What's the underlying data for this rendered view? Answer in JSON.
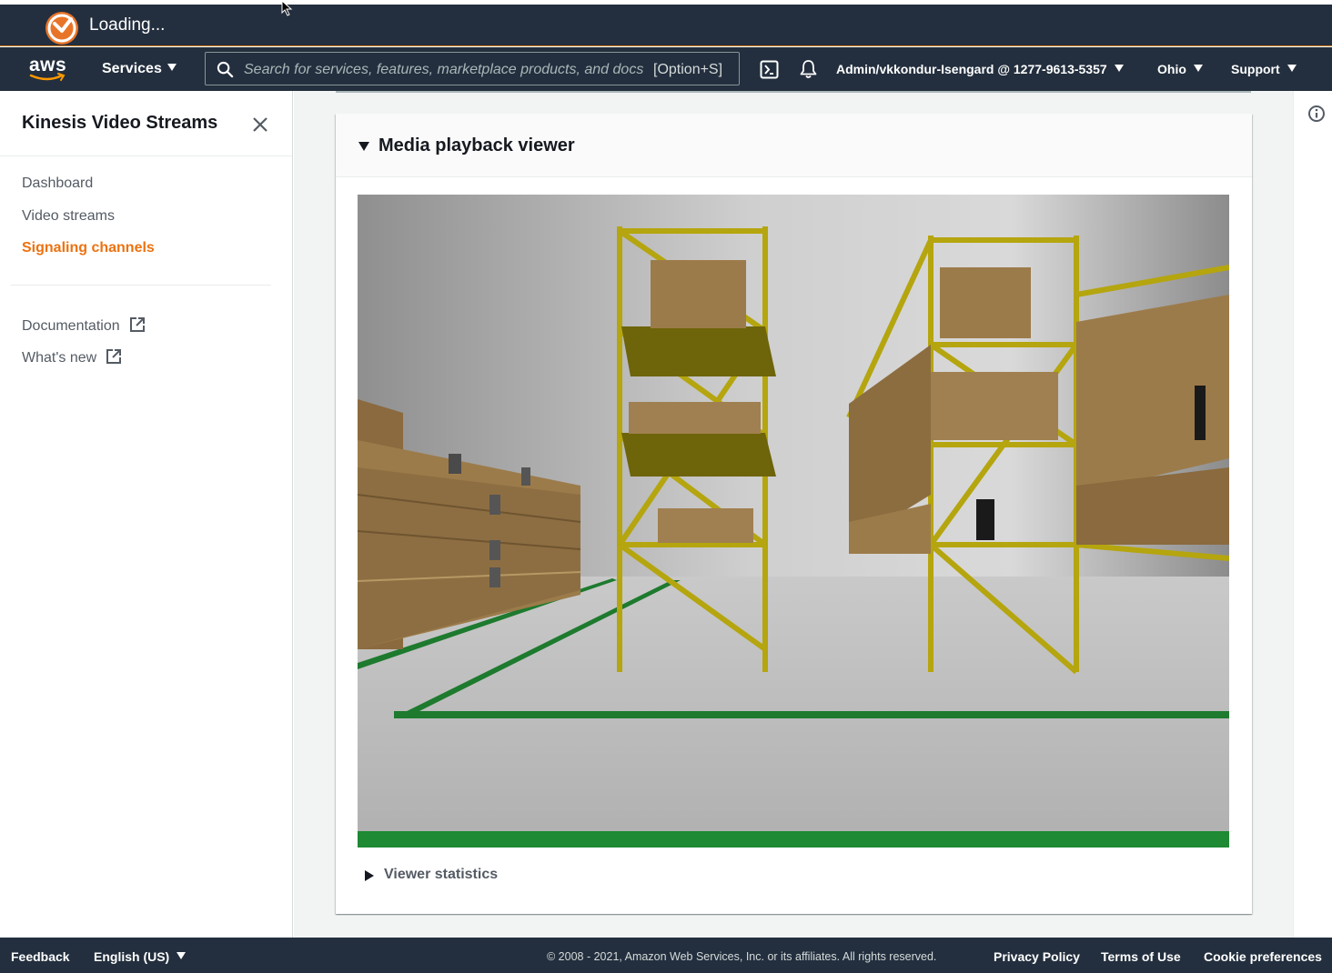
{
  "loading_bar": {
    "text": "Loading..."
  },
  "navbar": {
    "logo_text": "aws",
    "services_label": "Services",
    "search_placeholder": "Search for services, features, marketplace products, and docs",
    "search_shortcut": "[Option+S]",
    "account_label": "Admin/vkkondur-Isengard @ 1277-9613-5357",
    "region_label": "Ohio",
    "support_label": "Support"
  },
  "sidebar": {
    "title": "Kinesis Video Streams",
    "items": [
      {
        "label": "Dashboard",
        "active": false
      },
      {
        "label": "Video streams",
        "active": false
      },
      {
        "label": "Signaling channels",
        "active": true
      }
    ],
    "links": [
      {
        "label": "Documentation",
        "icon": "external-link-icon"
      },
      {
        "label": "What's new",
        "icon": "external-link-icon"
      }
    ]
  },
  "main": {
    "panel_title": "Media playback viewer",
    "viewer_statistics_label": "Viewer statistics",
    "video_content": "warehouse scene with yellow shelving racks and cardboard boxes"
  },
  "footer": {
    "feedback": "Feedback",
    "language": "English (US)",
    "copyright": "© 2008 - 2021, Amazon Web Services, Inc. or its affiliates. All rights reserved.",
    "privacy": "Privacy Policy",
    "terms": "Terms of Use",
    "cookies": "Cookie preferences"
  },
  "colors": {
    "nav_bg": "#232f3e",
    "accent_orange": "#ec7211",
    "page_bg": "#f2f3f3"
  }
}
